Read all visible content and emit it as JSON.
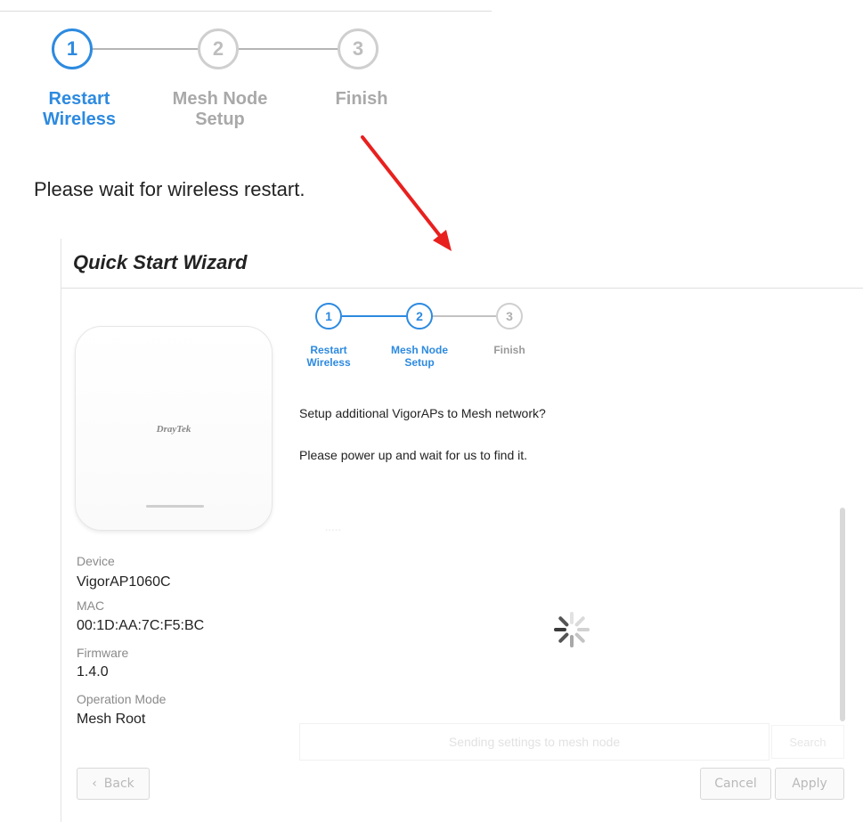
{
  "top_stepper": {
    "steps": [
      {
        "number": "1",
        "label_line1": "Restart",
        "label_line2": "Wireless",
        "state": "active"
      },
      {
        "number": "2",
        "label_line1": "Mesh Node",
        "label_line2": "Setup",
        "state": "inactive"
      },
      {
        "number": "3",
        "label_line1": "Finish",
        "label_line2": "",
        "state": "inactive"
      }
    ],
    "message": "Please wait for wireless restart."
  },
  "wizard": {
    "title": "Quick Start Wizard",
    "device_logo": "DrayTek",
    "device_info": {
      "device_label": "Device",
      "device_value": "VigorAP1060C",
      "mac_label": "MAC",
      "mac_value": "00:1D:AA:7C:F5:BC",
      "firmware_label": "Firmware",
      "firmware_value": "1.4.0",
      "mode_label": "Operation Mode",
      "mode_value": "Mesh Root"
    },
    "steps": [
      {
        "number": "1",
        "label_line1": "Restart",
        "label_line2": "Wireless",
        "state": "done"
      },
      {
        "number": "2",
        "label_line1": "Mesh Node",
        "label_line2": "Setup",
        "state": "active"
      },
      {
        "number": "3",
        "label_line1": "Finish",
        "label_line2": "",
        "state": "inactive"
      }
    ],
    "question": "Setup additional VigorAPs to Mesh network?",
    "instruction": "Please power up and wait for us to find it.",
    "status_text": "Sending settings to mesh node",
    "search_label": "Search",
    "back_label": "Back",
    "cancel_label": "Cancel",
    "apply_label": "Apply"
  },
  "colors": {
    "accent": "#2d8ae0",
    "arrow": "#e8201e",
    "inactive": "#bdbdbd"
  },
  "icons": [
    "right-arrow-annotation",
    "loading-spinner-icon",
    "chevron-left-icon"
  ]
}
